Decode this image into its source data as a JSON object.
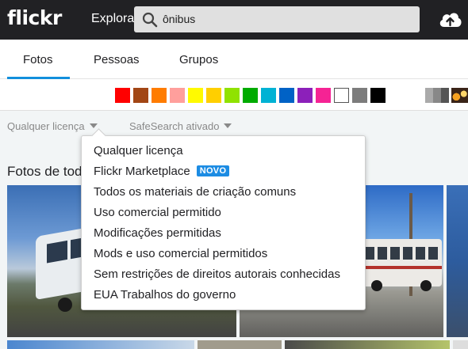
{
  "header": {
    "logo": "flickr",
    "explore_label": "Explorar",
    "search": {
      "value": "ônibus",
      "icon": "search-icon"
    },
    "upload_icon": "cloud-upload-icon"
  },
  "tabs": [
    {
      "label": "Fotos",
      "active": true
    },
    {
      "label": "Pessoas",
      "active": false
    },
    {
      "label": "Grupos",
      "active": false
    }
  ],
  "colors": [
    "#ff0000",
    "#a24615",
    "#ff7c00",
    "#ff9f9c",
    "#fffa00",
    "#ffcf00",
    "#90e200",
    "#00ab00",
    "#00b2d4",
    "#0062c6",
    "#8c20ba",
    "#f52394",
    "#ffffff",
    "#7c7c7c",
    "#000000"
  ],
  "filters": {
    "license": "Qualquer licença",
    "safesearch": "SafeSearch ativado"
  },
  "section_title": "Fotos de tod",
  "license_menu": {
    "items": [
      "Qualquer licença",
      "Flickr Marketplace",
      "Todos os materiais de criação comuns",
      "Uso comercial permitido",
      "Modificações permitidas",
      "Mods e uso comercial permitidos",
      "Sem restrições de direitos autorais conhecidas",
      "EUA Trabalhos do governo"
    ],
    "new_badge": "NOVO"
  },
  "theme": {
    "accent": "#128fdc",
    "badge": "#1c8ce3",
    "topbar": "#212124"
  }
}
